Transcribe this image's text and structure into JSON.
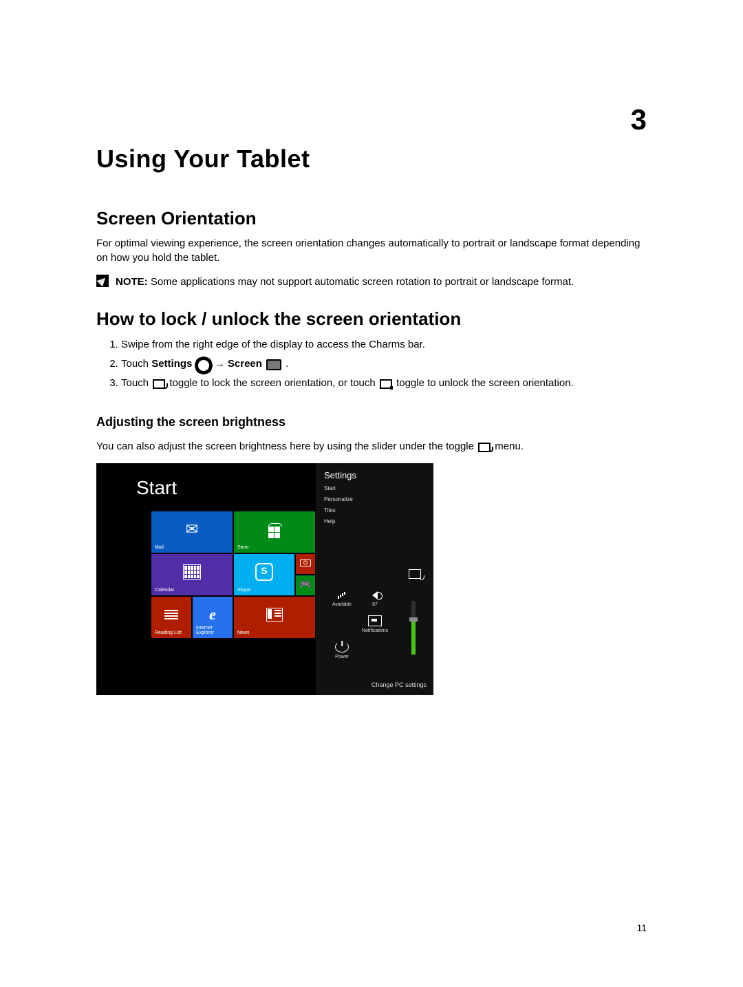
{
  "chapter_number": "3",
  "page_number": "11",
  "title": "Using Your Tablet",
  "section1": {
    "heading": "Screen Orientation",
    "para": "For optimal viewing experience, the screen orientation changes automatically to portrait or landscape format depending on how you hold the tablet.",
    "note_label": "NOTE:",
    "note_text": " Some applications may not support automatic screen rotation to portrait or landscape format."
  },
  "section2": {
    "heading": "How to lock / unlock the screen orientation",
    "step1": "Swipe from the right edge of the display to access the Charms bar.",
    "step2_a": "Touch ",
    "step2_settings": "Settings",
    "step2_arrow": " → ",
    "step2_screen": "Screen",
    "step2_dot": " .",
    "step3_a": "Touch ",
    "step3_b": " toggle to lock the screen orientation, or touch ",
    "step3_c": " toggle to unlock the screen orientation."
  },
  "section3": {
    "heading": "Adjusting the screen brightness",
    "para_a": "You can also adjust the screen brightness here by using the slider under the toggle ",
    "para_b": " menu."
  },
  "illustration": {
    "start_label": "Start",
    "tiles": {
      "mail": "Mail",
      "store": "Store",
      "calendar": "Calendar",
      "skype": "Skype",
      "reading": "Reading List",
      "ie": "Internet Explorer",
      "news": "News"
    },
    "settings_title": "Settings",
    "settings_items": [
      "Start",
      "Personalize",
      "Tiles",
      "Help"
    ],
    "bottom": {
      "available": "Available",
      "volume": "87",
      "notifications": "Notifications",
      "power": "Power"
    },
    "change_label": "Change PC settings"
  }
}
